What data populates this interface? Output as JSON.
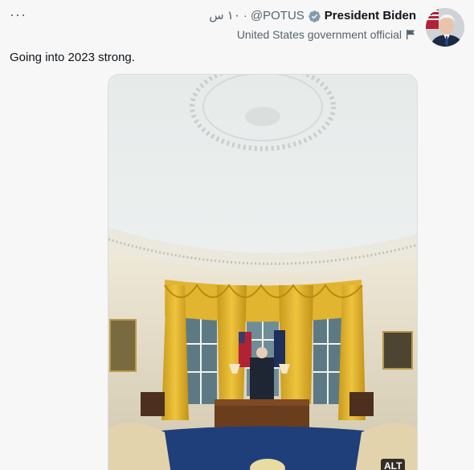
{
  "menu": {
    "more_label": "···"
  },
  "author": {
    "name": "President Biden",
    "handle": "@POTUS",
    "time": "١٠ س",
    "separator": "·",
    "label": "United States government official"
  },
  "tweet": {
    "text": "Going into 2023 strong."
  },
  "media": {
    "alt_label": "ALT"
  },
  "colors": {
    "verified": "#829aab",
    "text": "#0f1419",
    "secondary": "#536471"
  },
  "icons": [
    "more-icon",
    "verified-badge-icon",
    "government-flag-icon",
    "avatar"
  ]
}
